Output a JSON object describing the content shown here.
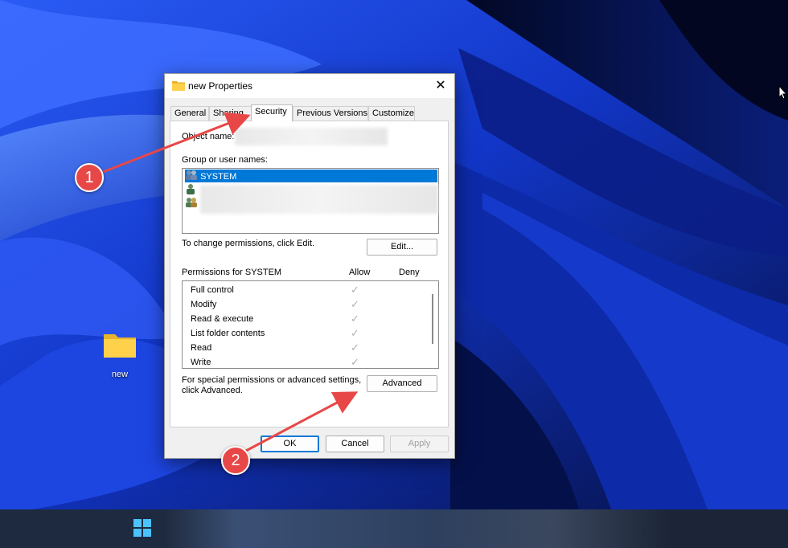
{
  "dialog": {
    "title": "new Properties",
    "tabs": [
      "General",
      "Sharing",
      "Security",
      "Previous Versions",
      "Customize"
    ],
    "active_tab": "Security",
    "object_name_label": "Object name:",
    "group_label": "Group or user names:",
    "users": [
      "SYSTEM"
    ],
    "change_text": "To change permissions, click Edit.",
    "edit_label": "Edit...",
    "permissions_label": "Permissions for SYSTEM",
    "allow_header": "Allow",
    "deny_header": "Deny",
    "permissions": [
      {
        "name": "Full control",
        "allow": true,
        "deny": false
      },
      {
        "name": "Modify",
        "allow": true,
        "deny": false
      },
      {
        "name": "Read & execute",
        "allow": true,
        "deny": false
      },
      {
        "name": "List folder contents",
        "allow": true,
        "deny": false
      },
      {
        "name": "Read",
        "allow": true,
        "deny": false
      },
      {
        "name": "Write",
        "allow": true,
        "deny": false
      }
    ],
    "special_text_1": "For special permissions or advanced settings,",
    "special_text_2": "click Advanced.",
    "advanced_label": "Advanced",
    "ok_label": "OK",
    "cancel_label": "Cancel",
    "apply_label": "Apply"
  },
  "desktop": {
    "icon_label": "new"
  },
  "annotations": {
    "step1": "1",
    "step2": "2",
    "color": "#e84747"
  },
  "colors": {
    "selection": "#0078d7",
    "wallpaper_dark": "#0a1a6a",
    "wallpaper_light": "#3a6cff"
  }
}
